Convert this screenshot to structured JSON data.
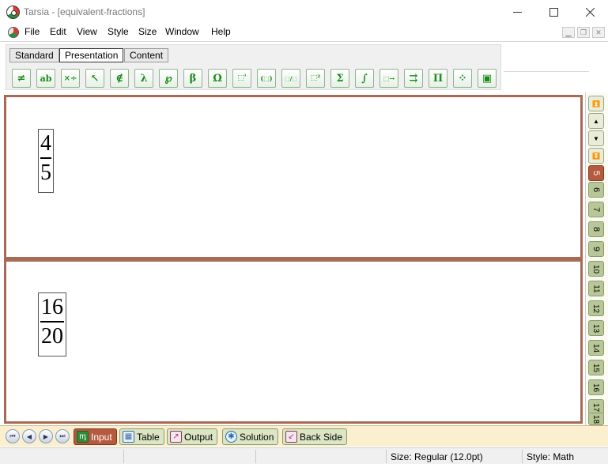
{
  "window": {
    "title": "Tarsia - [equivalent-fractions]"
  },
  "menu": {
    "items": [
      "File",
      "Edit",
      "View",
      "Style",
      "Size",
      "Window",
      "Help"
    ]
  },
  "toolbar": {
    "tabs": [
      {
        "label": "Standard"
      },
      {
        "label": "Presentation"
      },
      {
        "label": "Content"
      }
    ],
    "active_tab": "Presentation",
    "buttons": [
      {
        "name": "not-equal-icon",
        "glyph": "≠"
      },
      {
        "name": "text-box-icon",
        "glyph": "ab"
      },
      {
        "name": "multiply-divide-icon",
        "glyph": "×÷"
      },
      {
        "name": "arrow-icon",
        "glyph": "↖"
      },
      {
        "name": "not-element-icon",
        "glyph": "∉"
      },
      {
        "name": "lambda-icon",
        "glyph": "λ"
      },
      {
        "name": "symbol-icon",
        "glyph": "℘"
      },
      {
        "name": "beta-icon",
        "glyph": "β"
      },
      {
        "name": "omega-icon",
        "glyph": "Ω"
      },
      {
        "name": "superscript-box-icon",
        "glyph": "⬚'"
      },
      {
        "name": "parentheses-icon",
        "glyph": "(⬚)"
      },
      {
        "name": "fraction-icon",
        "glyph": "⬚/⬚"
      },
      {
        "name": "power-icon",
        "glyph": "⬚²"
      },
      {
        "name": "sum-icon",
        "glyph": "Σ"
      },
      {
        "name": "integral-icon",
        "glyph": "∫"
      },
      {
        "name": "under-arrow-icon",
        "glyph": "⬚→"
      },
      {
        "name": "over-arrow-icon",
        "glyph": "⇉"
      },
      {
        "name": "product-icon",
        "glyph": "Π"
      },
      {
        "name": "matrix-icon",
        "glyph": "⁘"
      },
      {
        "name": "box-icon",
        "glyph": "▣"
      }
    ]
  },
  "cards": [
    {
      "numerator": "4",
      "denominator": "5"
    },
    {
      "numerator": "16",
      "denominator": "20"
    }
  ],
  "page_strip": {
    "nav": [
      "⏫",
      "▲",
      "▼",
      "⏬"
    ],
    "pages": [
      "5",
      "6",
      "7",
      "8",
      "9",
      "10",
      "11",
      "12",
      "13",
      "14",
      "15",
      "16",
      "17",
      "18"
    ],
    "current_page": "5"
  },
  "bottom_tabs": [
    {
      "label": "Input",
      "icon": "input-icon"
    },
    {
      "label": "Table",
      "icon": "table-icon"
    },
    {
      "label": "Output",
      "icon": "output-icon"
    },
    {
      "label": "Solution",
      "icon": "solution-icon"
    },
    {
      "label": "Back Side",
      "icon": "back-side-icon"
    }
  ],
  "active_bottom_tab": "Input",
  "status": {
    "size": "Size: Regular (12.0pt)",
    "style": "Style: Math"
  },
  "colors": {
    "card_border": "#a86a55",
    "active_tab": "#b55a3e",
    "page_button": "#b8c797",
    "toolbar_icon": "#1a8a1a"
  }
}
